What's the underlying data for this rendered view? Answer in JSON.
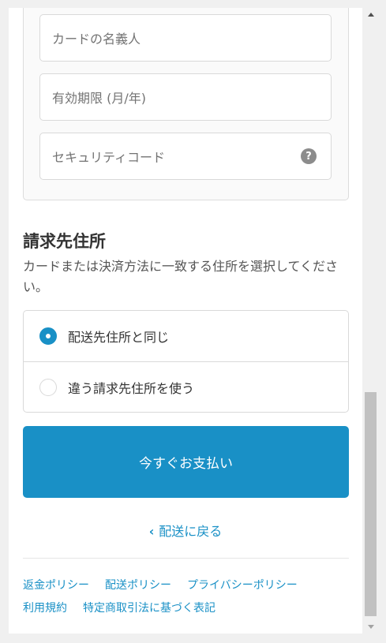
{
  "payment_fields": {
    "name_on_card": {
      "placeholder": "カードの名義人"
    },
    "expiry": {
      "placeholder": "有効期限 (月/年)"
    },
    "security_code": {
      "placeholder": "セキュリティコード",
      "help_glyph": "?"
    }
  },
  "billing": {
    "title": "請求先住所",
    "description": "カードまたは決済方法に一致する住所を選択してください。",
    "options": [
      {
        "label": "配送先住所と同じ",
        "selected": true
      },
      {
        "label": "違う請求先住所を使う",
        "selected": false
      }
    ]
  },
  "actions": {
    "pay_now": "今すぐお支払い",
    "back_chevron": "‹",
    "back_label": "配送に戻る"
  },
  "footer": {
    "links": [
      "返金ポリシー",
      "配送ポリシー",
      "プライバシーポリシー",
      "利用規約",
      "特定商取引法に基づく表記"
    ]
  },
  "colors": {
    "accent": "#1990c6",
    "border": "#d9d9d9",
    "scroll_thumb": "#c1c1c1"
  }
}
